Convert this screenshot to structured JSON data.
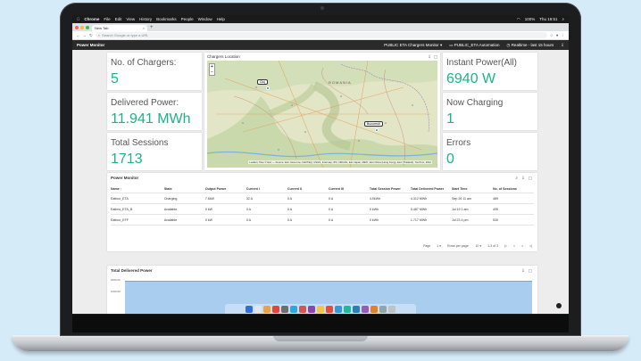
{
  "macos_menu": {
    "app": "Chrome",
    "items": [
      "File",
      "Edit",
      "View",
      "History",
      "Bookmarks",
      "People",
      "Window",
      "Help"
    ],
    "battery": "100%",
    "clock": "Thu 18:51"
  },
  "browser": {
    "tab_title": "New Tab",
    "new_tab": "+",
    "address_placeholder": "Search Google or type a URL"
  },
  "app": {
    "title": "Power Monitor",
    "dashboard_select": "PUBLIC ETA Chargers Monitor",
    "automation_label": "PUBLIC_ETA Automation",
    "time_range": "Realtime - last 15 hours"
  },
  "stats": {
    "chargers": {
      "label": "No. of Chargers:",
      "value": "5"
    },
    "delivered": {
      "label": "Delivered Power:",
      "value": "11.941 MWh"
    },
    "sessions": {
      "label": "Total Sessions",
      "value": "1713"
    },
    "instant": {
      "label": "Instant Power(All)",
      "value": "6940 W"
    },
    "charging": {
      "label": "Now Charging",
      "value": "1"
    },
    "errors": {
      "label": "Errors",
      "value": "0"
    }
  },
  "map": {
    "title": "Chargers Location",
    "zoom_in": "+",
    "zoom_out": "−",
    "region_labels": [
      "ROMANIA"
    ],
    "pins": [
      "Cluj",
      "Bucuresti"
    ],
    "attribution": "Leaflet | Tiles © Esri — Source: Esri, DeLorme, NAVTEQ, USGS, Intermap, iPC, NRCAN, Esri Japan, METI, Esri China (Hong Kong), Esri (Thailand), TomTom, 2012"
  },
  "table": {
    "title": "Power Monitor",
    "columns": [
      "Name",
      "State",
      "Output Power",
      "Current I",
      "Current II",
      "Current III",
      "Total Session Power",
      "Total Delivered Power",
      "Start Time",
      "No. of Sessions"
    ],
    "rows": [
      [
        "Eatbox_ETA",
        "Charging",
        "7.6kW",
        "32 A",
        "0 A",
        "0 A",
        "4.0kWh",
        "4.312 MWh",
        "Sep 26 11 am",
        "489"
      ],
      [
        "Eatbox_ETA_B",
        "Available",
        "0 kW",
        "0 A",
        "0 A",
        "0 A",
        "0 kWh",
        "5.487 MWh",
        "Jul 19 2 am",
        "495"
      ],
      [
        "Eatbox_EFF",
        "Available",
        "0 kW",
        "0 A",
        "0 A",
        "0 A",
        "0 kWh",
        "1.717 MWh",
        "Jul 23 4 pm",
        "530"
      ]
    ],
    "pager": {
      "page": "Page",
      "page_num": "1",
      "rows_label": "Rows per page:",
      "rows_value": "10",
      "range": "1-3 of 3",
      "first": "|<",
      "prev": "<",
      "next": ">",
      "last": ">|"
    }
  },
  "tdp": {
    "title": "Total Delivered Power",
    "y_ticks": [
      "2000.00",
      "1000.00"
    ]
  },
  "colors": {
    "value_green": "#1eb386",
    "chart_fill": "#a9cdee"
  }
}
